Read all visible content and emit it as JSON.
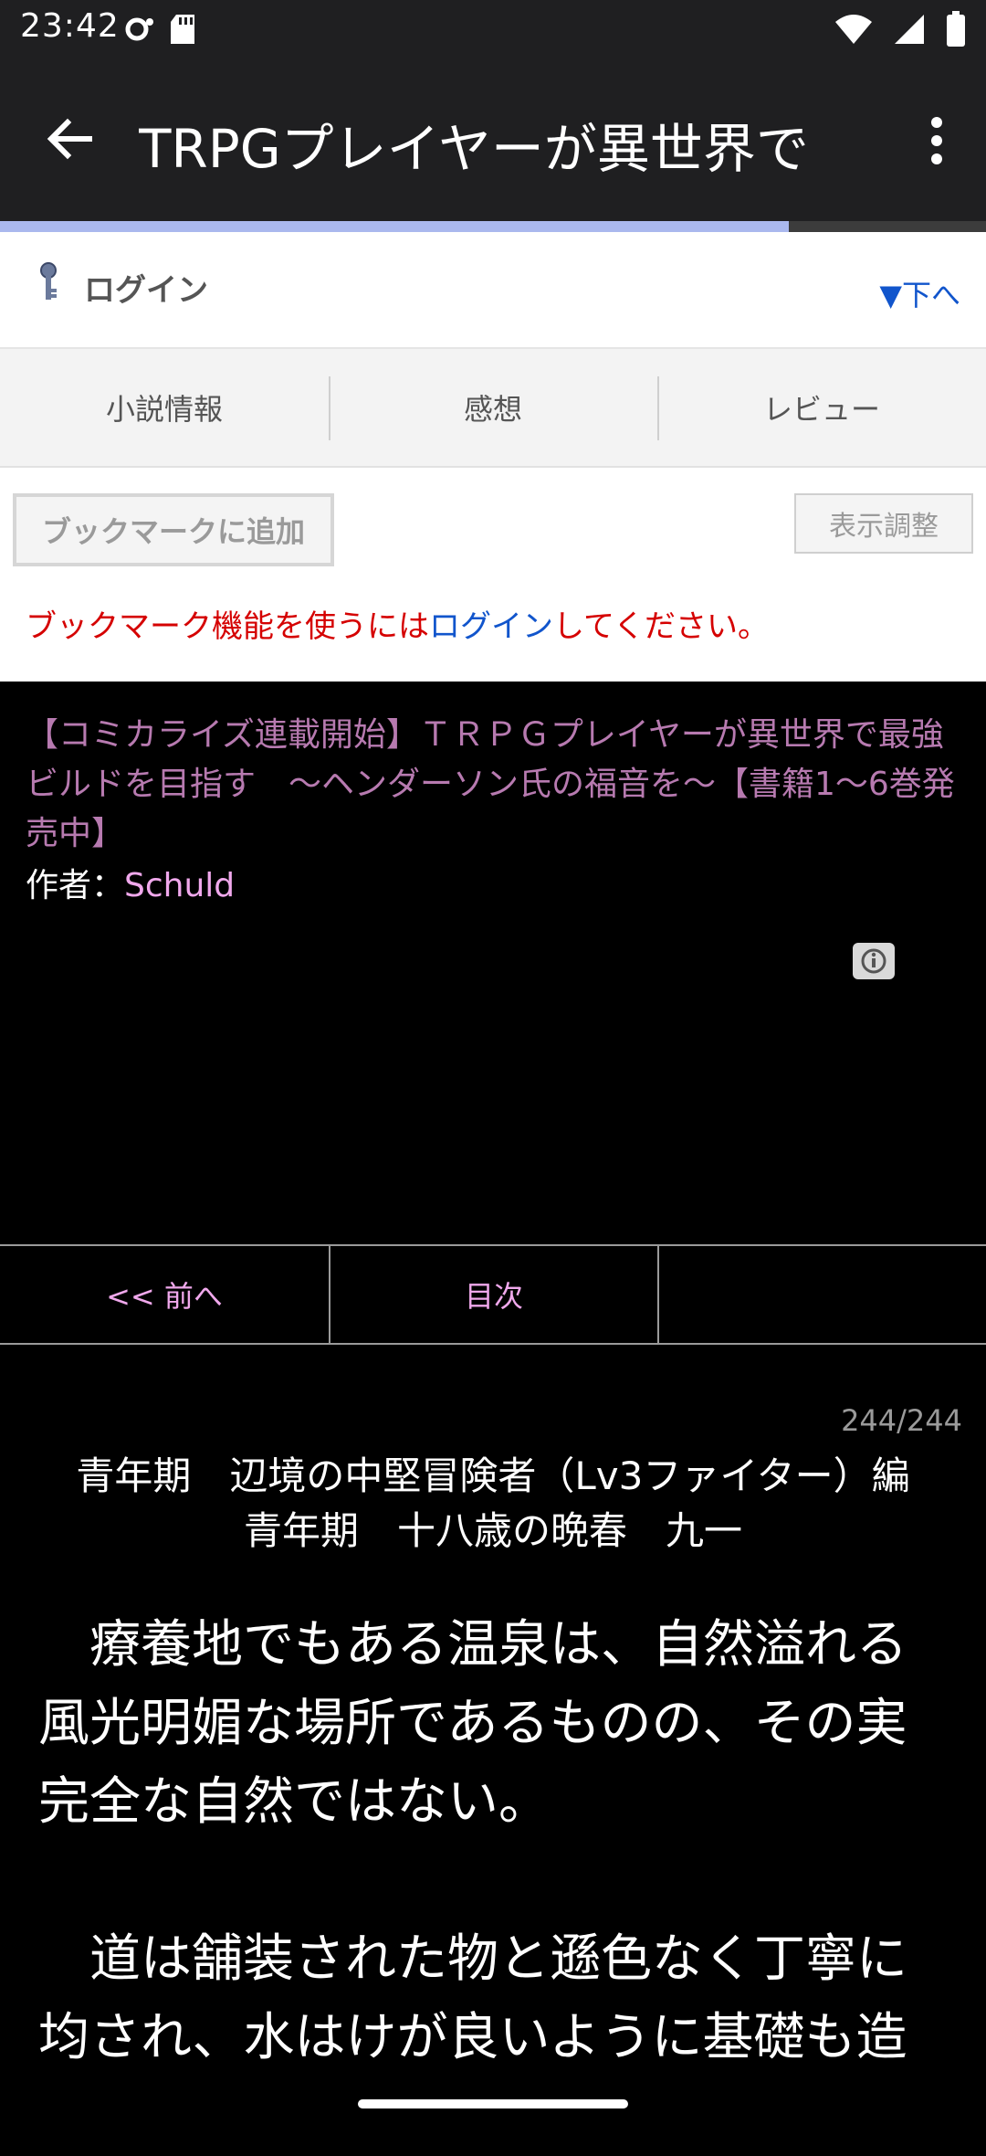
{
  "status_bar": {
    "time": "23:42",
    "icons": [
      "notification-icon",
      "sd-card-icon",
      "wifi-icon",
      "signal-icon",
      "battery-icon"
    ]
  },
  "app_bar": {
    "title": "TRPGプレイヤーが異世界で",
    "back_icon": "arrow-back-icon",
    "menu_icon": "more-vert-icon"
  },
  "page_progress": 0.8,
  "header": {
    "login_label": "ログイン",
    "down_label": "▼下へ"
  },
  "tabs": [
    "小説情報",
    "感想",
    "レビュー"
  ],
  "bookmark": {
    "add_label": "ブックマークに追加",
    "adjust_label": "表示調整",
    "message_before": "ブックマーク機能を使うには",
    "message_link": "ログイン",
    "message_after": "してください。"
  },
  "novel": {
    "title": "【コミカライズ連載開始】ＴＲＰＧプレイヤーが異世界で最強ビルドを目指す　～ヘンダーソン氏の福音を～【書籍1～6巻発売中】",
    "author_prefix": "作者：",
    "author_name": "Schuld"
  },
  "nav": {
    "prev": "<< 前へ",
    "toc": "目次",
    "next": ""
  },
  "chapter": {
    "counter": "244/244",
    "part_title": "青年期　辺境の中堅冒険者（Lv3ファイター）編",
    "episode_title": "青年期　十八歳の晩春　九一"
  },
  "body": [
    "療養地でもある温泉は、自然溢れる風光明媚な場所であるものの、その実完全な自然ではない。",
    "道は舗装された物と遜色なく丁寧に均され、水はけが良いように基礎も造"
  ],
  "colors": {
    "appbar_bg": "#1f1f21",
    "progress_fill": "#aab8ee",
    "link_blue": "#1155cc",
    "warning_red": "#d50000",
    "novel_title": "#b77ab0",
    "nav_link": "#f0a8ec"
  }
}
